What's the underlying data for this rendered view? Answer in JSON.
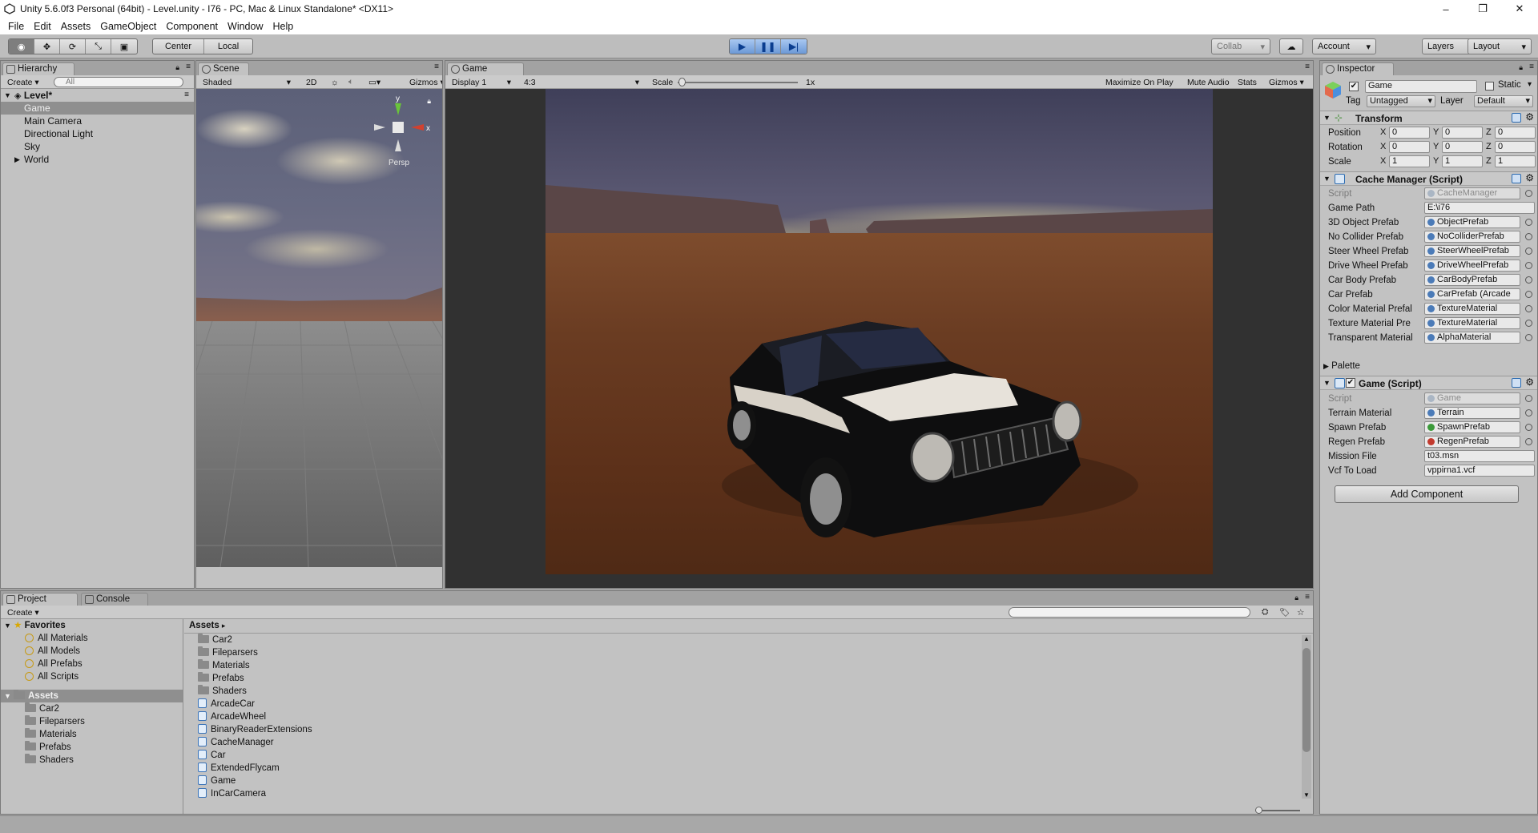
{
  "window": {
    "title": "Unity 5.6.0f3 Personal (64bit) - Level.unity - I76 - PC, Mac & Linux Standalone* <DX11>",
    "controls": [
      "–",
      "❐",
      "✕"
    ]
  },
  "menu": [
    "File",
    "Edit",
    "Assets",
    "GameObject",
    "Component",
    "Window",
    "Help"
  ],
  "toolbar": {
    "pivot": "Center",
    "space": "Local",
    "collab": "Collab",
    "account": "Account",
    "layers": "Layers",
    "layout": "Layout"
  },
  "hierarchy": {
    "tab": "Hierarchy",
    "create": "Create",
    "search_placeholder": "All",
    "scene": "Level*",
    "items": [
      "Game",
      "Main Camera",
      "Directional Light",
      "Sky",
      "World"
    ],
    "selected": "Game"
  },
  "scene": {
    "tab": "Scene",
    "shading": "Shaded",
    "mode_2d": "2D",
    "gizmos": "Gizmos",
    "persp": "Persp",
    "axis_y": "y",
    "axis_x": "x"
  },
  "game": {
    "tab": "Game",
    "display": "Display 1",
    "aspect": "4:3",
    "scale_label": "Scale",
    "scale_value": "1x",
    "maximize": "Maximize On Play",
    "mute": "Mute Audio",
    "stats": "Stats",
    "gizmos": "Gizmos"
  },
  "inspector": {
    "tab": "Inspector",
    "object_name": "Game",
    "static_label": "Static",
    "tag_label": "Tag",
    "tag_value": "Untagged",
    "layer_label": "Layer",
    "layer_value": "Default",
    "transform": {
      "title": "Transform",
      "rows": [
        {
          "label": "Position",
          "x": "0",
          "y": "0",
          "z": "0"
        },
        {
          "label": "Rotation",
          "x": "0",
          "y": "0",
          "z": "0"
        },
        {
          "label": "Scale",
          "x": "1",
          "y": "1",
          "z": "1"
        }
      ]
    },
    "cache_manager": {
      "title": "Cache Manager (Script)",
      "fields": [
        {
          "label": "Script",
          "value": "CacheManager"
        },
        {
          "label": "Game Path",
          "value": "E:\\i76"
        },
        {
          "label": "3D Object Prefab",
          "value": "ObjectPrefab"
        },
        {
          "label": "No Collider Prefab",
          "value": "NoColliderPrefab"
        },
        {
          "label": "Steer Wheel Prefab",
          "value": "SteerWheelPrefab"
        },
        {
          "label": "Drive Wheel Prefab",
          "value": "DriveWheelPrefab"
        },
        {
          "label": "Car Body Prefab",
          "value": "CarBodyPrefab"
        },
        {
          "label": "Car Prefab",
          "value": "CarPrefab (Arcade"
        },
        {
          "label": "Color Material Prefal",
          "value": "TextureMaterial"
        },
        {
          "label": "Texture Material Pre",
          "value": "TextureMaterial"
        },
        {
          "label": "Transparent Material",
          "value": "AlphaMaterial"
        }
      ],
      "palette": "Palette"
    },
    "game_script": {
      "title": "Game (Script)",
      "fields": [
        {
          "label": "Script",
          "value": "Game"
        },
        {
          "label": "Terrain Material",
          "value": "Terrain"
        },
        {
          "label": "Spawn Prefab",
          "value": "SpawnPrefab"
        },
        {
          "label": "Regen Prefab",
          "value": "RegenPrefab"
        },
        {
          "label": "Mission File",
          "value": "t03.msn"
        },
        {
          "label": "Vcf To Load",
          "value": "vppirna1.vcf"
        }
      ]
    },
    "add_component": "Add Component"
  },
  "project": {
    "tab_project": "Project",
    "tab_console": "Console",
    "create": "Create",
    "favorites_label": "Favorites",
    "favorites": [
      "All Materials",
      "All Models",
      "All Prefabs",
      "All Scripts"
    ],
    "assets_label": "Assets",
    "asset_folders": [
      "Car2",
      "Fileparsers",
      "Materials",
      "Prefabs",
      "Shaders"
    ],
    "breadcrumb": "Assets",
    "content_folders": [
      "Car2",
      "Fileparsers",
      "Materials",
      "Prefabs",
      "Shaders"
    ],
    "content_scripts": [
      "ArcadeCar",
      "ArcadeWheel",
      "BinaryReaderExtensions",
      "CacheManager",
      "Car",
      "ExtendedFlycam",
      "Game",
      "InCarCamera"
    ]
  },
  "colors": {
    "editor_bg": "#c2c2c2",
    "play_accent": "#6b98d6",
    "selection": "#8f8f8f"
  }
}
